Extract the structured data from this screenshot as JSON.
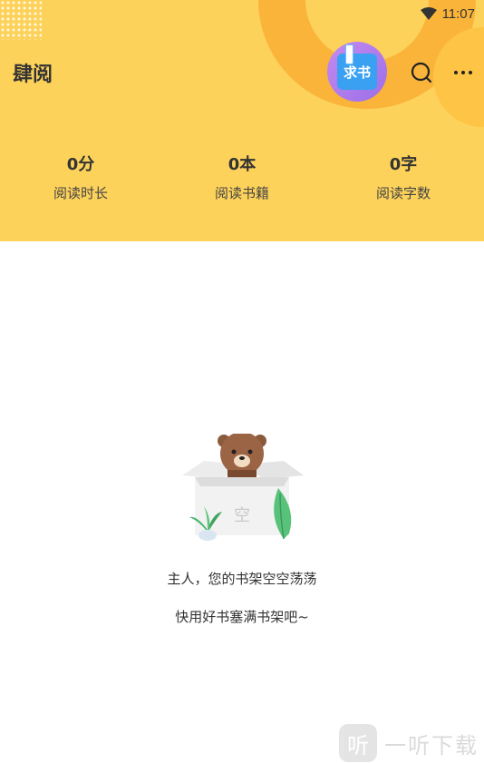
{
  "status_bar": {
    "time": "11:07"
  },
  "header": {
    "app_title": "肆阅",
    "request_book_label": "求书",
    "colors": {
      "background": "#fdd25a",
      "ring": "#fbb43a"
    }
  },
  "stats": [
    {
      "value": "0分",
      "label": "阅读时长"
    },
    {
      "value": "0本",
      "label": "阅读书籍"
    },
    {
      "value": "0字",
      "label": "阅读字数"
    }
  ],
  "empty_state": {
    "box_label": "空",
    "line1": "主人，您的书架空空荡荡",
    "line2": "快用好书塞满书架吧~"
  },
  "watermark": {
    "logo": "听",
    "text": "一听下载"
  },
  "icons": [
    "wifi-icon",
    "search-icon",
    "more-icon",
    "request-book-icon",
    "bear-in-box-illustration"
  ]
}
